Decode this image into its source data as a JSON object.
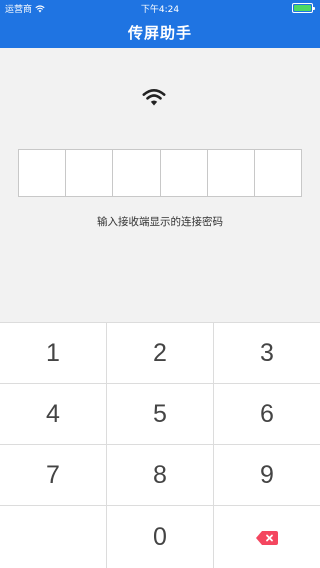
{
  "status_bar": {
    "carrier": "运营商",
    "time": "下午4:24",
    "battery_level": 1.0,
    "icons": [
      "wifi-icon",
      "battery-icon"
    ]
  },
  "header": {
    "title": "传屏助手"
  },
  "main": {
    "icon": "wifi-icon",
    "pin_length": 6,
    "pin_value": "",
    "hint": "输入接收端显示的连接密码"
  },
  "keypad": {
    "keys": [
      "1",
      "2",
      "3",
      "4",
      "5",
      "6",
      "7",
      "8",
      "9",
      "",
      "0"
    ],
    "delete_icon": "backspace-icon",
    "delete_color": "#f4465f"
  },
  "colors": {
    "accent": "#1f74e2",
    "background": "#f2f2f2"
  }
}
